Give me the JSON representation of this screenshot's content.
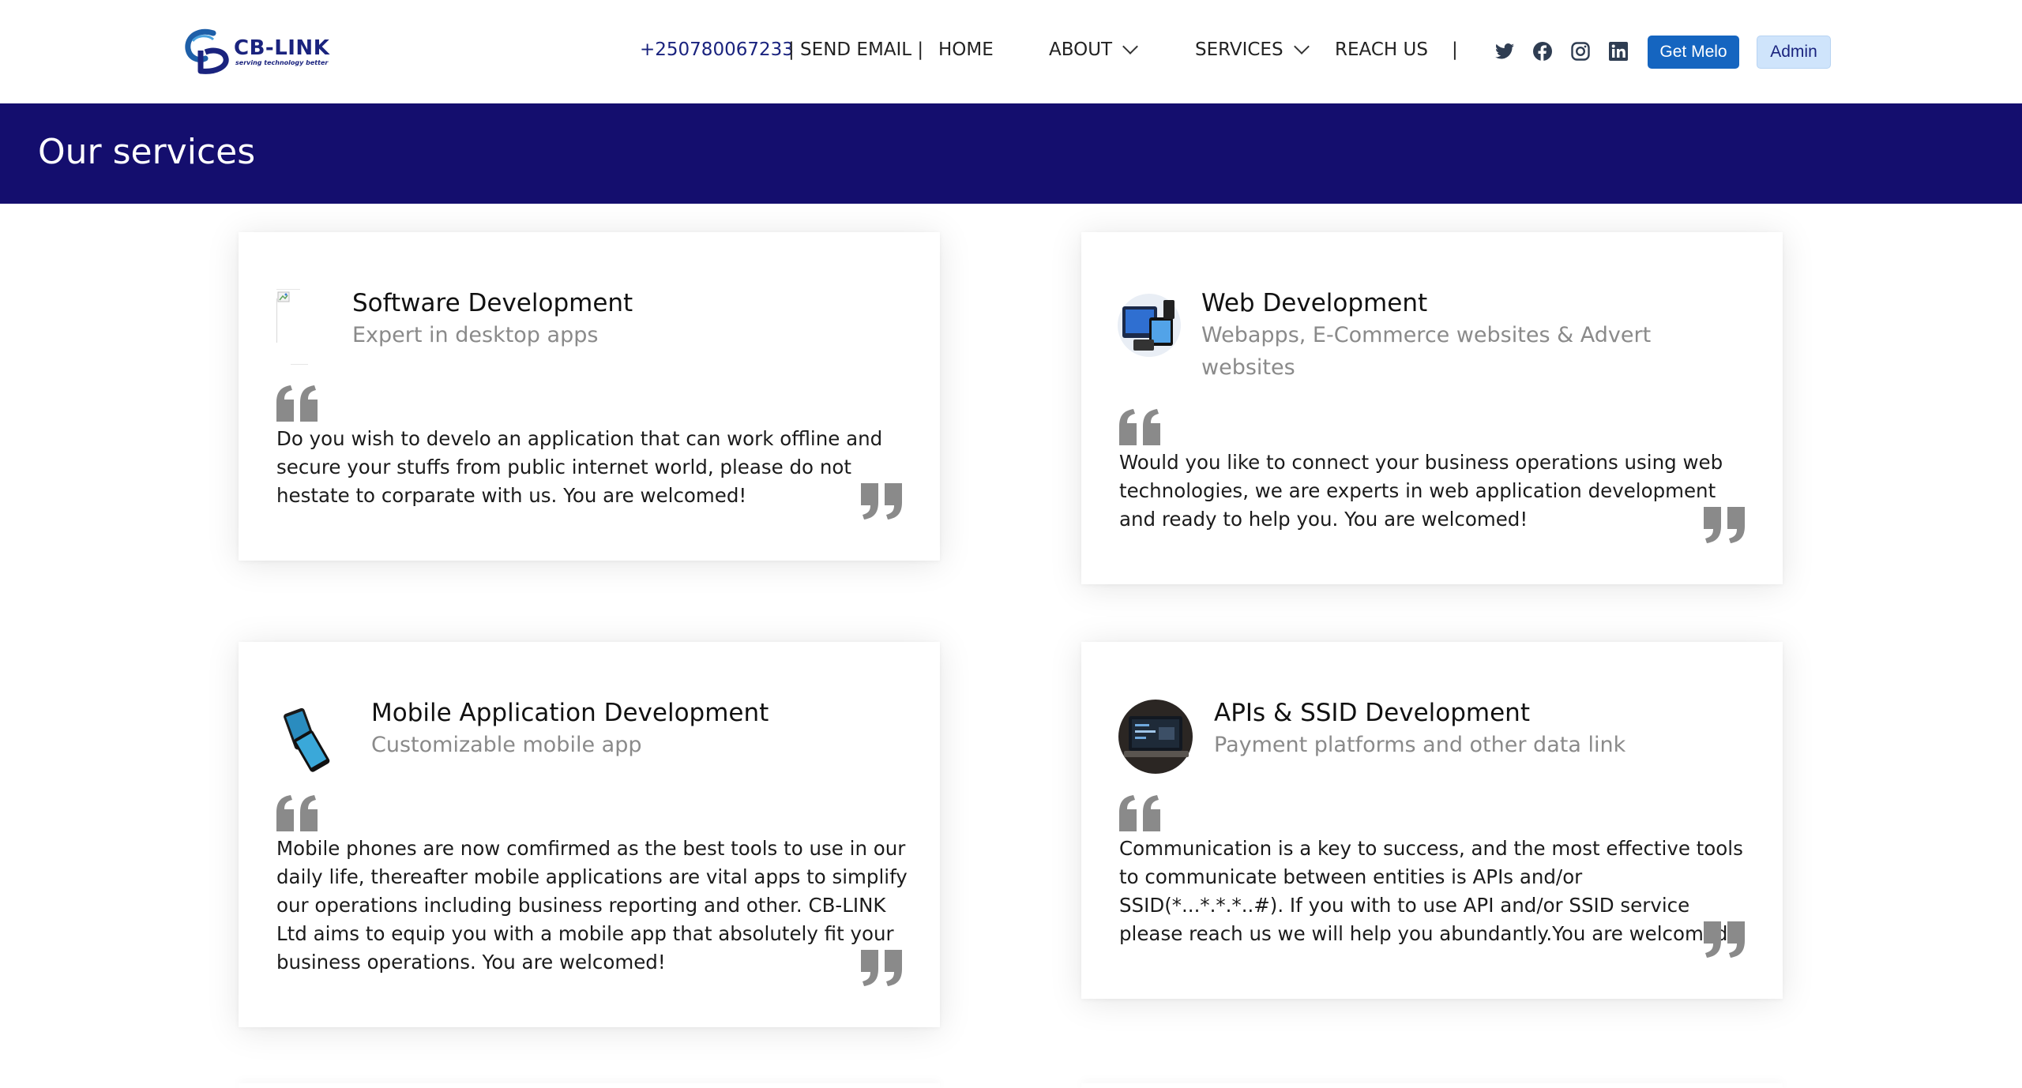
{
  "header": {
    "logo": {
      "name": "CB-LINK",
      "tagline": "serving technology better"
    },
    "phone": "+250780067233",
    "email_label": "| SEND EMAIL |",
    "nav": {
      "home": "HOME",
      "about": "ABOUT",
      "services": "SERVICES",
      "reach": "REACH US",
      "separator": "|"
    },
    "social_icons": [
      "twitter-icon",
      "facebook-icon",
      "instagram-icon",
      "linkedin-icon"
    ],
    "get_melo_label": "Get Melo",
    "admin_label": "Admin"
  },
  "banner": {
    "title": "Our services"
  },
  "colors": {
    "banner": "#140e6e",
    "primary_button": "#1565c0",
    "admin_button": "#cfe4fb",
    "quote": "#8a8a8a"
  },
  "services": [
    {
      "title": "Software Development",
      "subtitle": "Expert in desktop apps",
      "text": "Do you wish to develo an application that can work offline and secure your stuffs from public internet world, please do not hestate to corparate with us. You are welcomed!"
    },
    {
      "title": "Web Development",
      "subtitle": "Webapps, E-Commerce websites & Advert websites",
      "text": "Would you like to connect your business operations using web technologies, we are experts in web application development and ready to help you. You are welcomed!"
    },
    {
      "title": "Mobile Application Development",
      "subtitle": "Customizable mobile app",
      "text": "Mobile phones are now comfirmed as the best tools to use in our daily life, thereafter mobile applications are vital apps to simplify our operations including business reporting and other. CB-LINK Ltd aims to equip you with a mobile app that absolutely fit your business operations. You are welcomed!"
    },
    {
      "title": "APIs & SSID Development",
      "subtitle": "Payment platforms and other data link",
      "text": "Communication is a key to success, and the most effective tools to communicate between entities is APIs and/or SSID(*...*.*.*..#). If you with to use API and/or SSID service please reach us we will help you abundantly.You are welcomed!"
    }
  ]
}
